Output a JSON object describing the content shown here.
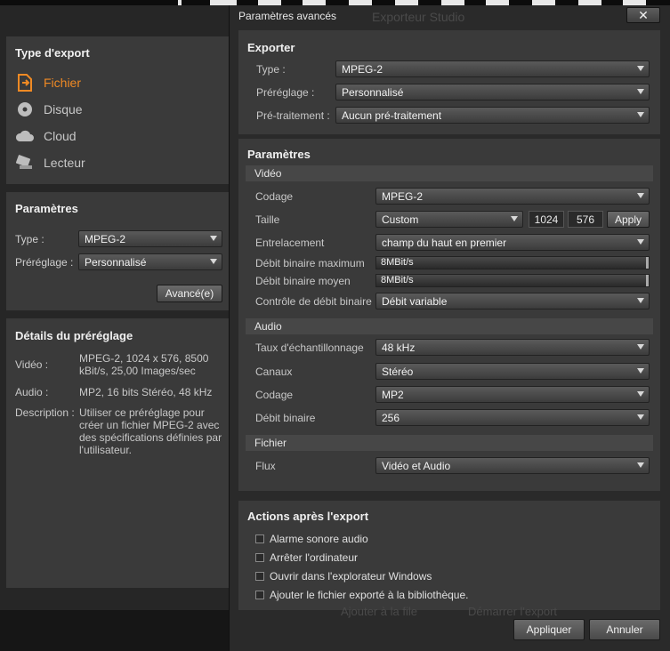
{
  "background": {
    "title": "Exporteur Studio",
    "footer_left": "Ajouter à la file",
    "footer_right": "Démarrer l'export"
  },
  "export_type": {
    "heading": "Type d'export",
    "items": [
      {
        "label": "Fichier",
        "icon": "file-export-icon",
        "active": true
      },
      {
        "label": "Disque",
        "icon": "disc-icon"
      },
      {
        "label": "Cloud",
        "icon": "cloud-icon"
      },
      {
        "label": "Lecteur",
        "icon": "device-icon"
      }
    ]
  },
  "params_panel": {
    "heading": "Paramètres",
    "type_label": "Type :",
    "type_value": "MPEG-2",
    "preset_label": "Préréglage :",
    "preset_value": "Personnalisé",
    "advanced_button": "Avancé(e)"
  },
  "preset_details": {
    "heading": "Détails du préréglage",
    "video_label": "Vidéo :",
    "video_value": "MPEG-2, 1024 x 576, 8500 kBit/s, 25,00 Images/sec",
    "audio_label": "Audio :",
    "audio_value": "MP2, 16 bits Stéréo, 48 kHz",
    "desc_label": "Description :",
    "desc_value": "Utiliser ce préréglage pour créer un fichier MPEG-2 avec des spécifications définies par l'utilisateur."
  },
  "dialog": {
    "title": "Paramètres avancés",
    "close": "✕",
    "exporter": {
      "heading": "Exporter",
      "type_label": "Type :",
      "type_value": "MPEG-2",
      "preset_label": "Préréglage :",
      "preset_value": "Personnalisé",
      "pre_label": "Pré-traitement :",
      "pre_value": "Aucun pré-traitement"
    },
    "params": {
      "heading": "Paramètres",
      "video": {
        "heading": "Vidéo",
        "codec_label": "Codage",
        "codec_value": "MPEG-2",
        "size_label": "Taille",
        "size_value": "Custom",
        "width": "1024",
        "height": "576",
        "apply": "Apply",
        "interlace_label": "Entrelacement",
        "interlace_value": "champ du haut en premier",
        "max_label": "Débit binaire maximum",
        "max_value": "8MBit/s",
        "avg_label": "Débit binaire moyen",
        "avg_value": "8MBit/s",
        "control_label": "Contrôle de débit binaire",
        "control_value": "Débit variable"
      },
      "audio": {
        "heading": "Audio",
        "rate_label": "Taux d'échantillonnage",
        "rate_value": "48 kHz",
        "channels_label": "Canaux",
        "channels_value": "Stéréo",
        "codec_label": "Codage",
        "codec_value": "MP2",
        "bitrate_label": "Débit binaire",
        "bitrate_value": "256"
      },
      "file": {
        "heading": "Fichier",
        "stream_label": "Flux",
        "stream_value": "Vidéo et Audio"
      }
    },
    "actions": {
      "heading": "Actions après l'export",
      "items": [
        "Alarme sonore audio",
        "Arrêter l'ordinateur",
        "Ouvrir dans l'explorateur Windows",
        "Ajouter le fichier exporté à la bibliothèque."
      ]
    },
    "ok": "Appliquer",
    "cancel": "Annuler"
  }
}
